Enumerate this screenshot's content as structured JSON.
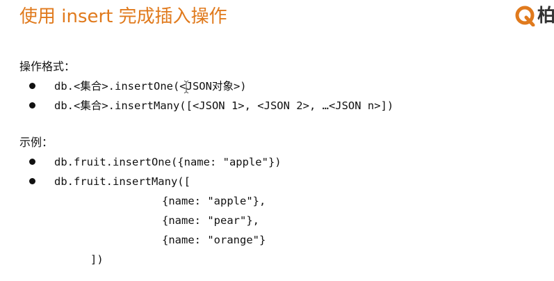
{
  "slide": {
    "title": "使用 insert 完成插入操作"
  },
  "logo": {
    "text": " 柏",
    "color": "#e07a1d"
  },
  "format_section": {
    "heading": "操作格式：",
    "items": [
      "db.<集合>.insertOne(<JSON对象>)",
      "db.<集合>.insertMany([<JSON 1>, <JSON 2>, …<JSON n>])"
    ]
  },
  "example_section": {
    "heading": "示例：",
    "items": [
      "db.fruit.insertOne({name: \"apple\"})",
      "db.fruit.insertMany(["
    ],
    "continuation": [
      "{name: \"apple\"},",
      "{name: \"pear\"},",
      "{name: \"orange\"}",
      "])"
    ]
  },
  "colors": {
    "title": "#e07a1d",
    "text": "#111111"
  }
}
